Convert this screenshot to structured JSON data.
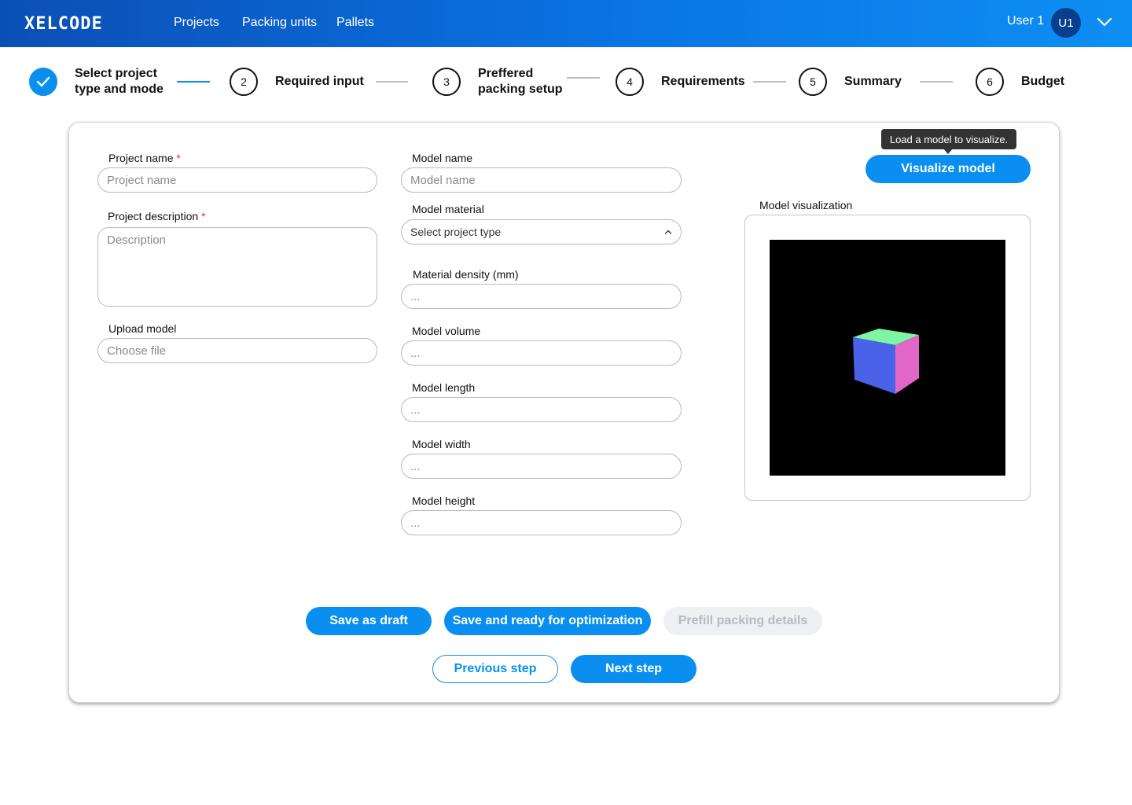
{
  "header": {
    "logo": "XELCODE",
    "nav": [
      "Projects",
      "Packing units",
      "Pallets"
    ],
    "user_name": "User 1",
    "avatar_initials": "U1"
  },
  "stepper": {
    "steps": [
      {
        "number": "",
        "label_line1": "Select project",
        "label_line2": "type and mode",
        "status": "done"
      },
      {
        "number": "2",
        "label_line1": "Required input",
        "label_line2": "",
        "status": "pending"
      },
      {
        "number": "3",
        "label_line1": "Preffered",
        "label_line2": "packing setup",
        "status": "pending"
      },
      {
        "number": "4",
        "label_line1": "Requirements",
        "label_line2": "",
        "status": "pending"
      },
      {
        "number": "5",
        "label_line1": "Summary",
        "label_line2": "",
        "status": "pending"
      },
      {
        "number": "6",
        "label_line1": "Budget",
        "label_line2": "",
        "status": "pending"
      }
    ]
  },
  "form": {
    "project_name_label": "Project name",
    "project_name_placeholder": "Project name",
    "project_description_label": "Project description",
    "project_description_placeholder": "Description",
    "required_mark": "*",
    "upload_model_label": "Upload model",
    "upload_model_placeholder": "Choose file",
    "model_name_label": "Model name",
    "model_name_placeholder": "Model name",
    "model_material_label": "Model material",
    "model_material_value": "Select project type",
    "material_density_label": "Material density (mm)",
    "material_density_placeholder": "...",
    "model_volume_label": "Model volume",
    "model_volume_placeholder": "...",
    "model_length_label": "Model length",
    "model_length_placeholder": "...",
    "model_width_label": "Model width",
    "model_width_placeholder": "...",
    "model_height_label": "Model height",
    "model_height_placeholder": "..."
  },
  "visualization": {
    "tooltip": "Load a model to visualize.",
    "visualize_button": "Visualize model",
    "label": "Model visualization",
    "cube_colors": {
      "top": "#7ef5a3",
      "front": "#4a62e8",
      "side": "#e066c8",
      "background": "#000000"
    }
  },
  "actions": {
    "save_draft": "Save as draft",
    "save_ready": "Save and ready for optimization",
    "prefill": "Prefill packing details",
    "previous": "Previous step",
    "next": "Next step"
  },
  "colors": {
    "accent": "#0a8ff0",
    "header_dark": "#0b4fb5",
    "required": "#e0302f",
    "disabled_bg": "#eef0f4"
  }
}
